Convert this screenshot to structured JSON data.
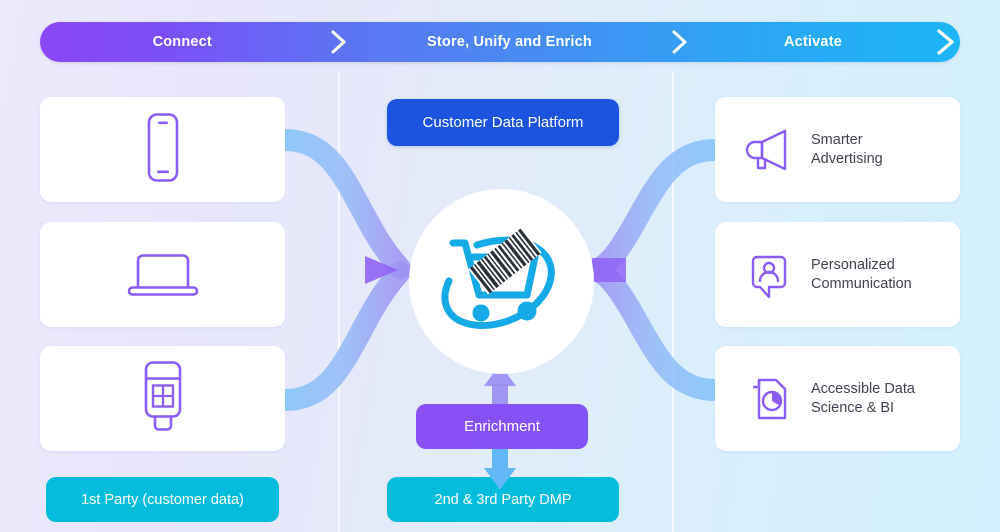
{
  "banner": {
    "stages": [
      {
        "label": "Connect"
      },
      {
        "label": "Store, Unify and Enrich"
      },
      {
        "label": "Activate"
      }
    ],
    "chevron_icon": "chevron-right-icon",
    "colors": {
      "start": "#8b46f7",
      "middle": "#4a8af3",
      "end": "#1db6f7"
    }
  },
  "connect": {
    "sources": [
      {
        "icon": "mobile-phone-icon",
        "name": "mobile-device-source"
      },
      {
        "icon": "laptop-icon",
        "name": "laptop-source"
      },
      {
        "icon": "pos-terminal-icon",
        "name": "pos-terminal-source"
      }
    ],
    "footer_label": "1st Party (customer data)",
    "footer_color": "#04bcdb"
  },
  "store": {
    "platform_label": "Customer Data Platform",
    "platform_color": "#1c54e0",
    "hub_icon": "shopping-cart-barcode-logo",
    "enrichment_label": "Enrichment",
    "enrichment_color": "#8a4ff5",
    "footer_label": "2nd & 3rd Party DMP",
    "footer_color": "#04bcdb",
    "arrow_up_icon": "arrow-up-icon",
    "arrow_down_icon": "arrow-down-icon"
  },
  "activate": {
    "outcomes": [
      {
        "icon": "megaphone-icon",
        "label": "Smarter\nAdvertising"
      },
      {
        "icon": "speech-bubble-person-icon",
        "label": "Personalized\nCommunication"
      },
      {
        "icon": "document-pie-chart-icon",
        "label": "Accessible Data\nScience & BI"
      }
    ]
  },
  "flows": {
    "inbound_icon": "merge-arrow-icon",
    "outbound_icon": "split-arrow-icon",
    "ribbon_color": "#7fb8f7",
    "arrowhead_color": "#8b5cf6"
  },
  "theme": {
    "accent_purple": "#8b5cf6",
    "accent_cyan": "#04bcdb",
    "accent_blue": "#1c54e0",
    "card_bg": "#ffffff",
    "text_color": "#3f4350"
  }
}
